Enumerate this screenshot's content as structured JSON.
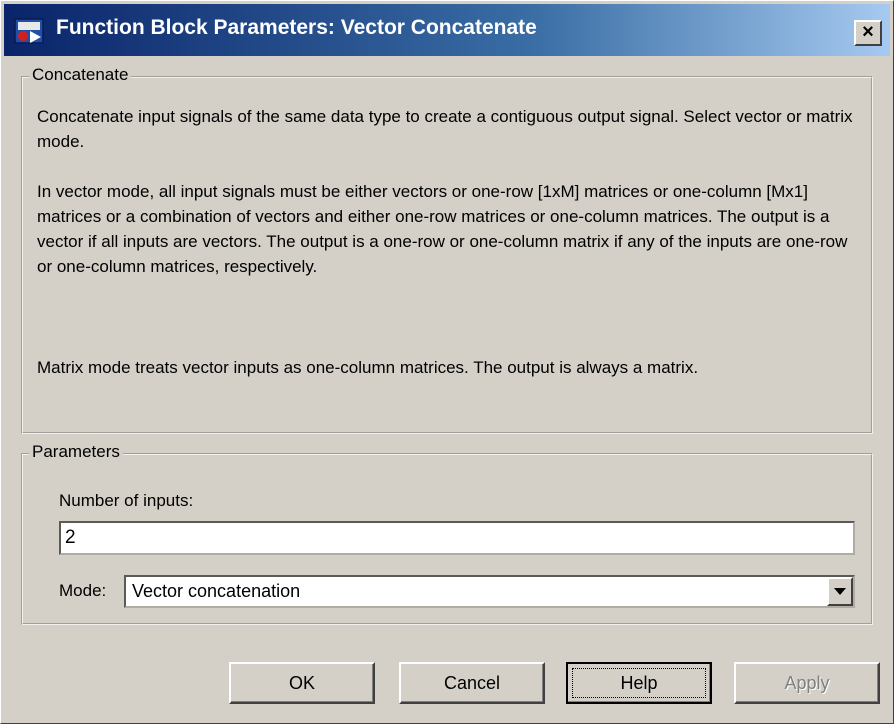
{
  "window": {
    "title": "Function Block Parameters: Vector Concatenate",
    "close_symbol": "×",
    "icon": "simulink-block-icon"
  },
  "concatenate_group": {
    "legend": "Concatenate",
    "paragraphs": [
      "Concatenate input signals of the same data type to create a contiguous output signal. Select vector or matrix mode.",
      "In vector mode, all input signals must be either vectors or one-row [1xM] matrices or one-column [Mx1] matrices or a combination of vectors and either one-row matrices or one-column matrices. The output is a vector if all inputs are vectors. The output is a one-row or one-column matrix if any of the inputs are one-row or one-column matrices, respectively.",
      "Matrix mode treats vector inputs as one-column matrices. The output is always a matrix."
    ]
  },
  "parameters_group": {
    "legend": "Parameters",
    "num_inputs_label": "Number of inputs:",
    "num_inputs_value": "2",
    "mode_label": "Mode:",
    "mode_value": "Vector concatenation"
  },
  "buttons": {
    "ok": "OK",
    "cancel": "Cancel",
    "help": "Help",
    "apply": "Apply"
  },
  "colors": {
    "titlebar_start": "#0a246a",
    "titlebar_end": "#a6caf0",
    "face": "#d4d0c8"
  }
}
